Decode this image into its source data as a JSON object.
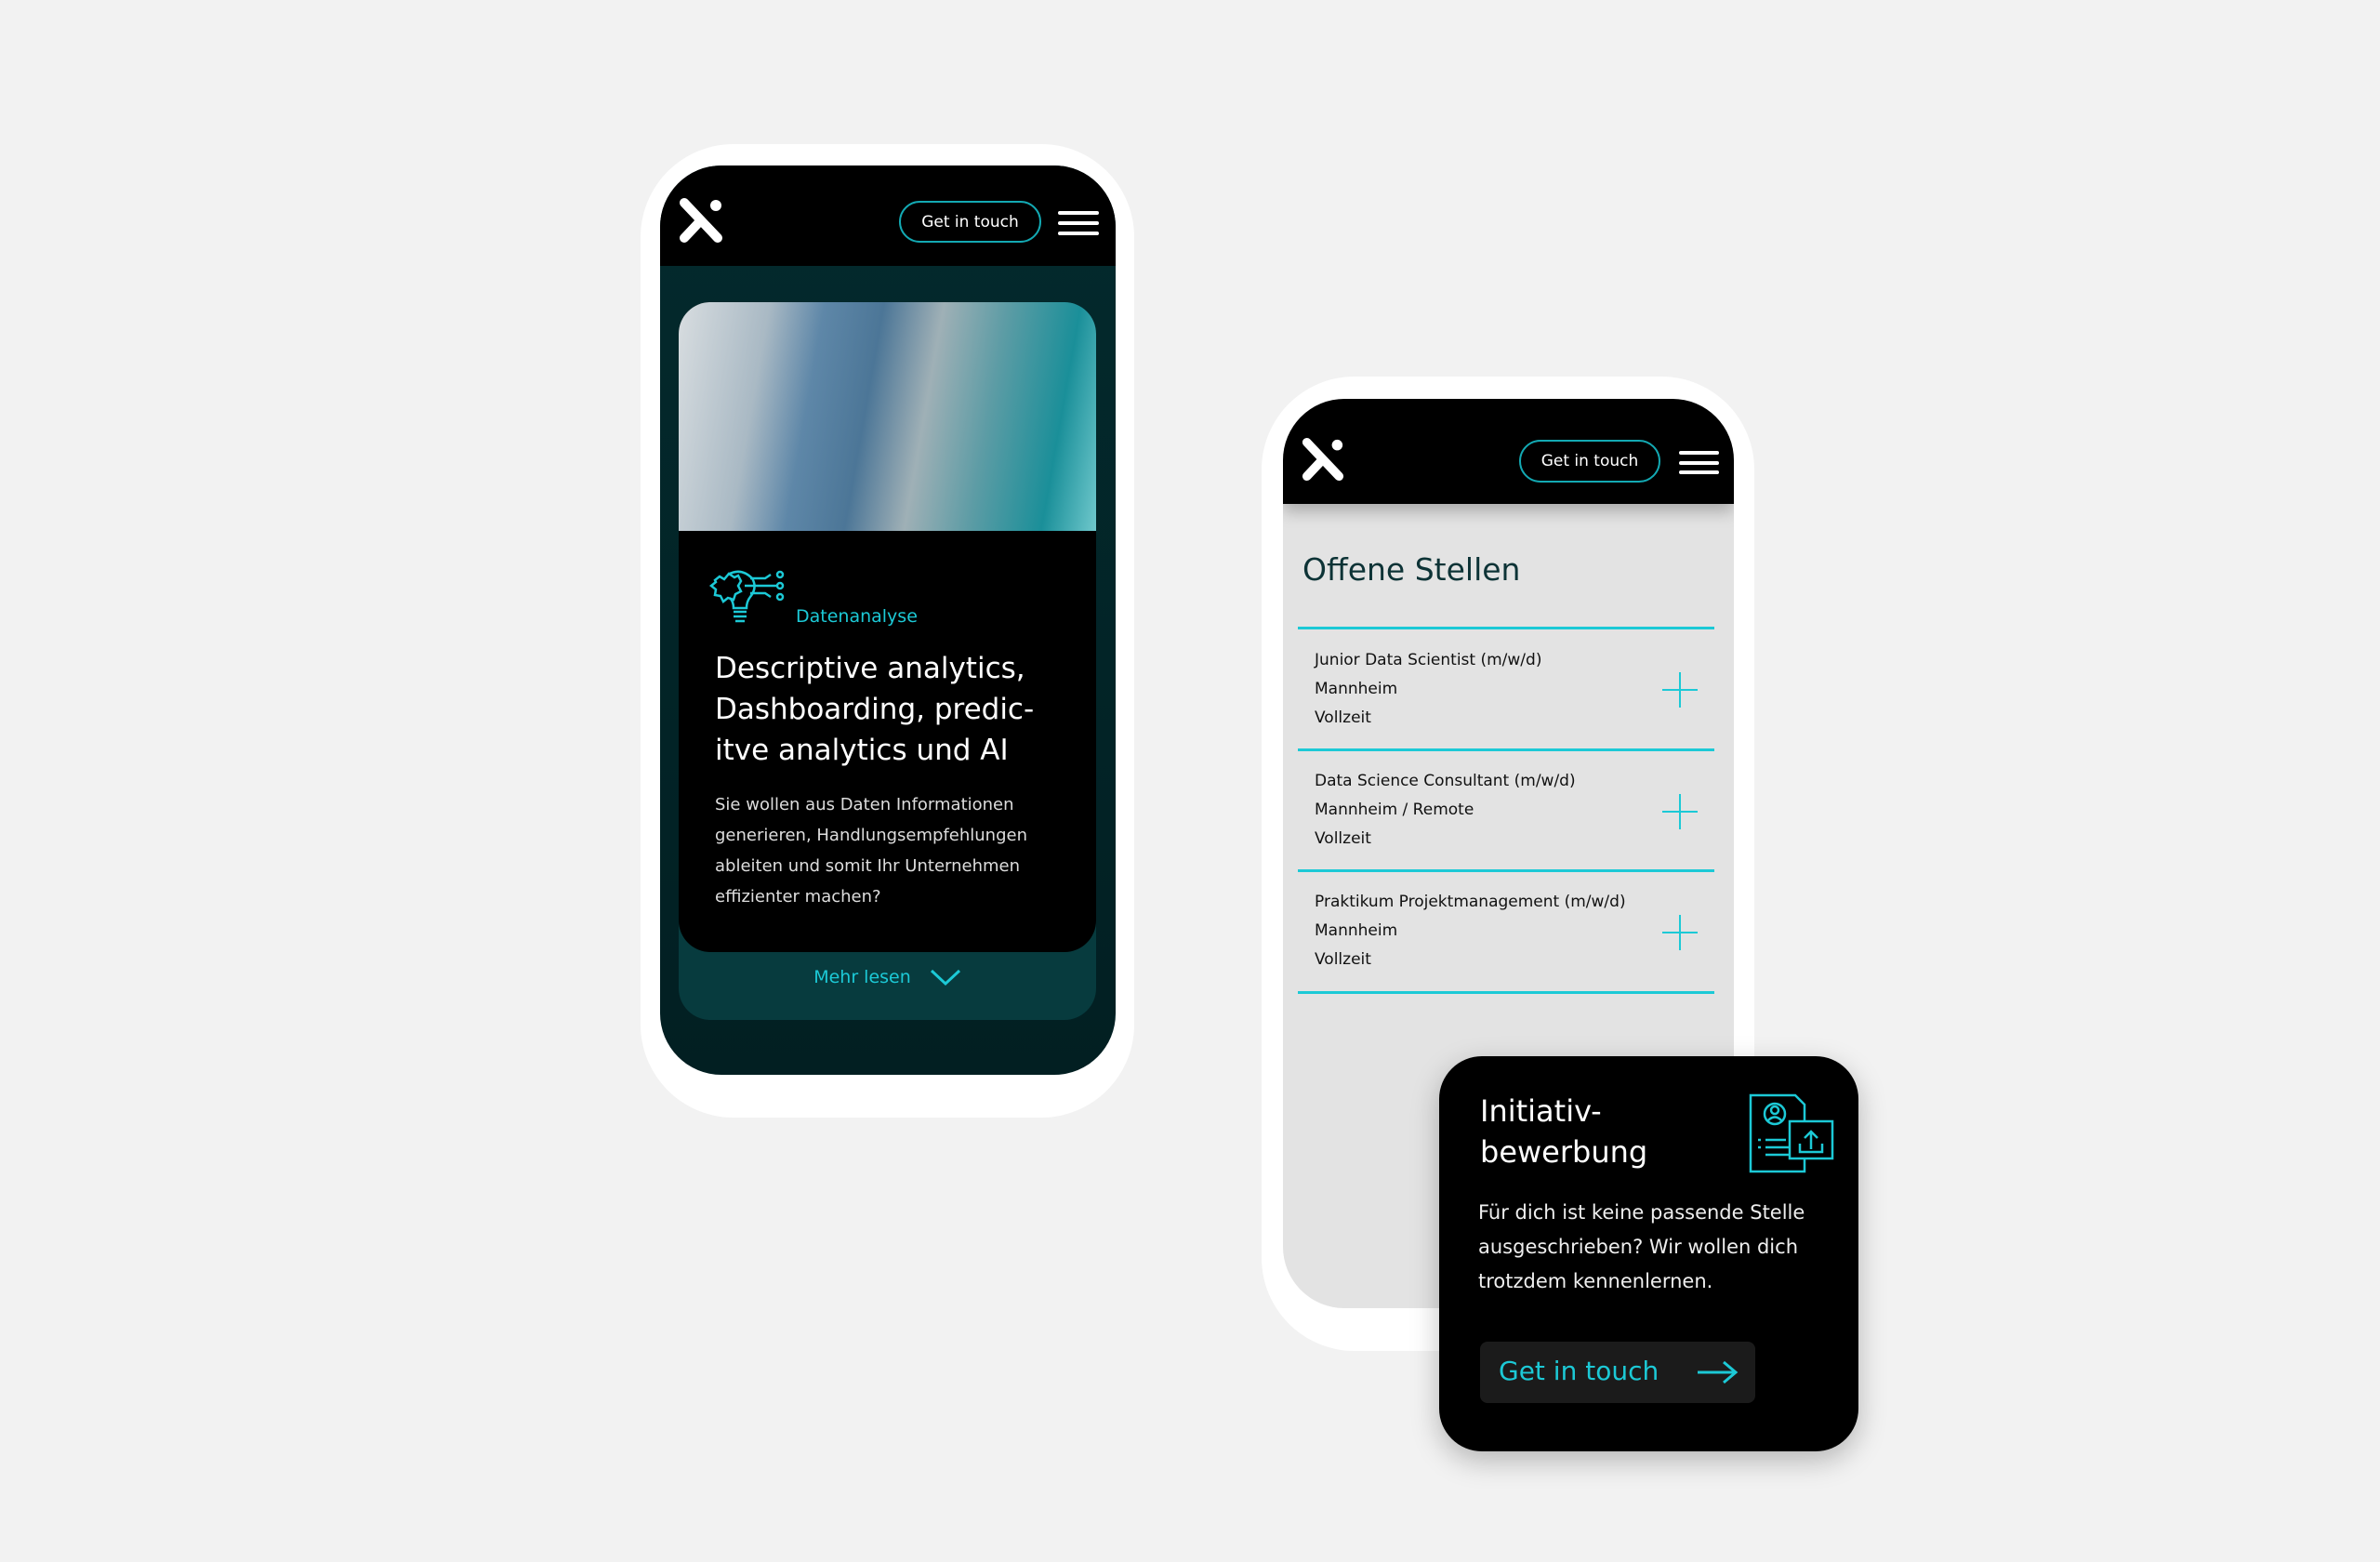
{
  "colors": {
    "accent": "#1cc9d6",
    "background": "#f2f2f2",
    "dark_teal": "#032a2d"
  },
  "phone1": {
    "header": {
      "logo": "x-logo",
      "cta": "Get in touch",
      "menu_icon": "hamburger-icon"
    },
    "card": {
      "image": "man-working-on-laptop-photo",
      "icon": "lightbulb-gear-circuit-icon",
      "category": "Datenanalyse",
      "title": "Descriptive analytics, Dashboarding, predic-itve analytics und AI",
      "title_lines": [
        "Descriptive analytics,",
        "Dashboarding, predic-",
        "itve analytics und AI"
      ],
      "body_lines": [
        "Sie wollen aus Daten Informationen",
        "generieren, Handlungsempfehlungen",
        "ableiten und somit Ihr Unternehmen",
        "effizienter machen?"
      ]
    },
    "more": {
      "label": "Mehr lesen",
      "icon": "chevron-down-icon"
    }
  },
  "phone2": {
    "header": {
      "logo": "x-logo",
      "cta": "Get in touch",
      "menu_icon": "hamburger-icon"
    },
    "title": "Offene Stellen",
    "jobs": [
      {
        "title": "Junior Data Scientist (m/w/d)",
        "location": "Mannheim",
        "type": "Vollzeit"
      },
      {
        "title": "Data Science Consultant (m/w/d)",
        "location": "Mannheim / Remote",
        "type": "Vollzeit"
      },
      {
        "title": "Praktikum Projektmanagement (m/w/d)",
        "location": "Mannheim",
        "type": "Vollzeit"
      }
    ]
  },
  "initiative": {
    "title_lines": [
      "Initiativ-",
      "bewerbung"
    ],
    "icon": "resume-upload-icon",
    "body_lines": [
      "Für dich ist keine passende Stelle",
      "ausgeschrieben? Wir wollen dich",
      "trotzdem kennenlernen."
    ],
    "cta": "Get in touch",
    "cta_icon": "arrow-right-icon"
  }
}
